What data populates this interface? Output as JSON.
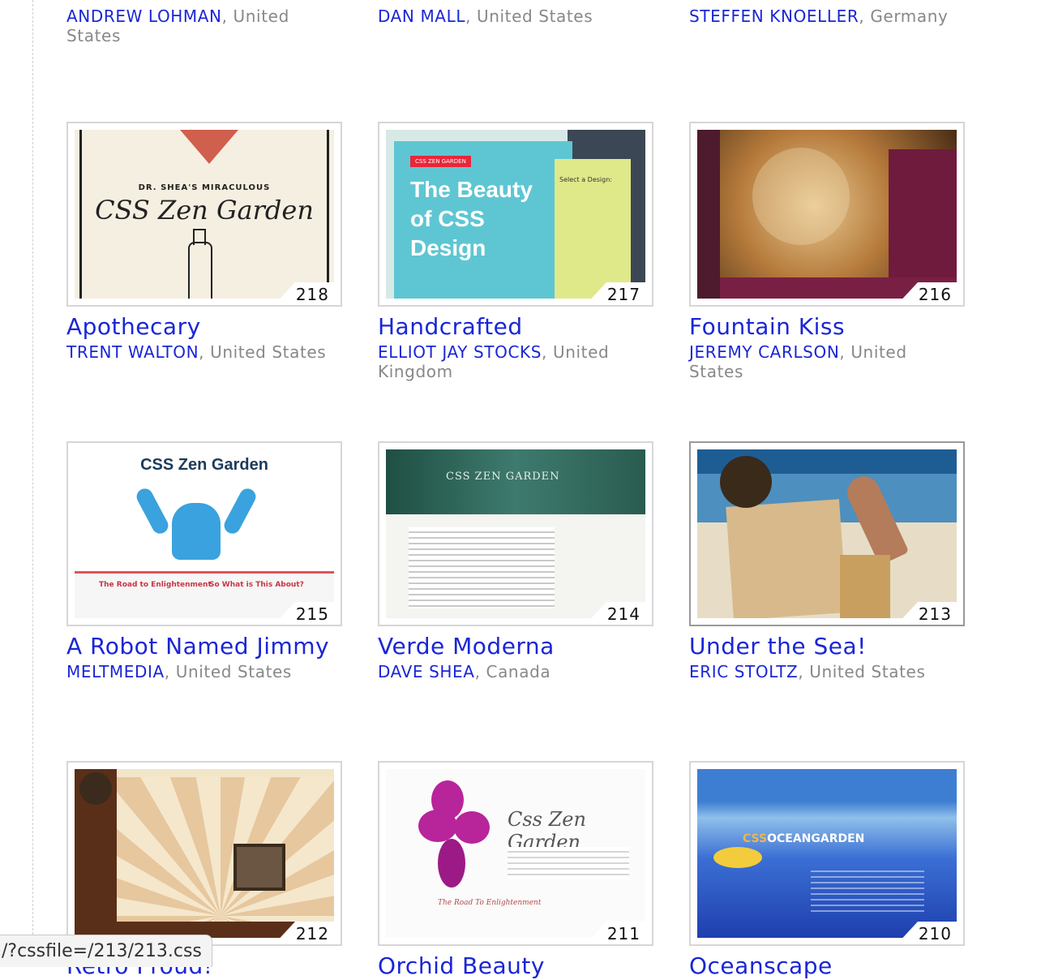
{
  "top_row": [
    {
      "author": "ANDREW LOHMAN",
      "country": "United States"
    },
    {
      "author": "DAN MALL",
      "country": "United States"
    },
    {
      "author": "STEFFEN KNOELLER",
      "country": "Germany"
    }
  ],
  "designs": [
    {
      "number": "218",
      "title": "Apothecary",
      "author": "TRENT WALTON",
      "country": "United States"
    },
    {
      "number": "217",
      "title": "Handcrafted",
      "author": "ELLIOT JAY STOCKS",
      "country": "United Kingdom"
    },
    {
      "number": "216",
      "title": "Fountain Kiss",
      "author": "JEREMY CARLSON",
      "country": "United States"
    },
    {
      "number": "215",
      "title": "A Robot Named Jimmy",
      "author": "MELTMEDIA",
      "country": "United States"
    },
    {
      "number": "214",
      "title": "Verde Moderna",
      "author": "DAVE SHEA",
      "country": "Canada"
    },
    {
      "number": "213",
      "title": "Under the Sea!",
      "author": "ERIC STOLTZ",
      "country": "United States"
    },
    {
      "number": "212",
      "title": "Retro Proud!",
      "author": "",
      "country": ""
    },
    {
      "number": "211",
      "title": "Orchid Beauty",
      "author": "",
      "country": ""
    },
    {
      "number": "210",
      "title": "Oceanscape",
      "author": "",
      "country": ""
    }
  ],
  "thumb_text": {
    "t218_sub": "DR. SHEA'S MIRACULOUS",
    "t218_big": "CSS Zen Garden",
    "t217_tag": "CSS ZEN GARDEN",
    "t217_head": "The Beauty of CSS Design",
    "t217_side_title": "Select a Design:",
    "t215_head": "CSS Zen Garden",
    "t215_sec1": "The Road to Enlightenment",
    "t215_sec2": "So What is This About?",
    "t214_head": "CSS ZEN GARDEN",
    "t211_brand": "Css Zen Garden",
    "t211_road": "The Road To Enlightenment",
    "t210_logo_a": "CSS",
    "t210_logo_b": "OCEANGARDEN"
  },
  "status_bar": {
    "url": "/?cssfile=/213/213.css"
  },
  "colors": {
    "link": "#1a26d6",
    "muted": "#888888",
    "frame": "#d6d6d6"
  }
}
